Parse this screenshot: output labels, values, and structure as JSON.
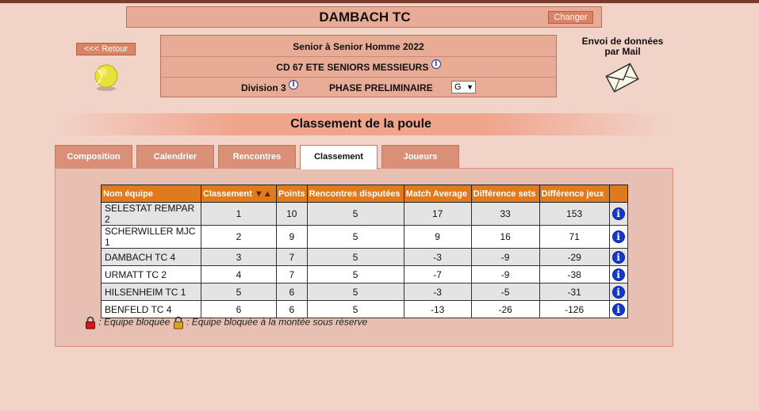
{
  "club": {
    "name": "DAMBACH TC",
    "change_label": "Changer"
  },
  "nav": {
    "back_label": "<<< Retour"
  },
  "competition": {
    "category": "Senior  à Senior  Homme  2022",
    "championship": "CD 67 ETE SENIORS MESSIEURS",
    "division": "Division 3",
    "phase": "PHASE PRELIMINAIRE",
    "poule_selected": "G"
  },
  "mail": {
    "line1": "Envoi de données",
    "line2": "par Mail"
  },
  "section_title": "Classement de la poule",
  "tabs": [
    {
      "label": "Composition",
      "active": false
    },
    {
      "label": "Calendrier",
      "active": false
    },
    {
      "label": "Rencontres",
      "active": false
    },
    {
      "label": "Classement",
      "active": true
    },
    {
      "label": "Joueurs",
      "active": false
    }
  ],
  "table": {
    "headers": {
      "team": "Nom équipe",
      "rank": "Classement",
      "points": "Points",
      "played": "Rencontres disputées",
      "match_avg": "Match Average",
      "sets_diff": "Différence sets",
      "games_diff": "Différence jeux"
    },
    "rows": [
      {
        "team": "SELESTAT REMPAR 2",
        "rank": "1",
        "points": "10",
        "played": "5",
        "match_avg": "17",
        "sets_diff": "33",
        "games_diff": "153"
      },
      {
        "team": "SCHERWILLER MJC 1",
        "rank": "2",
        "points": "9",
        "played": "5",
        "match_avg": "9",
        "sets_diff": "16",
        "games_diff": "71"
      },
      {
        "team": "DAMBACH TC 4",
        "rank": "3",
        "points": "7",
        "played": "5",
        "match_avg": "-3",
        "sets_diff": "-9",
        "games_diff": "-29"
      },
      {
        "team": "URMATT TC 2",
        "rank": "4",
        "points": "7",
        "played": "5",
        "match_avg": "-7",
        "sets_diff": "-9",
        "games_diff": "-38"
      },
      {
        "team": "HILSENHEIM TC 1",
        "rank": "5",
        "points": "6",
        "played": "5",
        "match_avg": "-3",
        "sets_diff": "-5",
        "games_diff": "-31"
      },
      {
        "team": "BENFELD TC 4",
        "rank": "6",
        "points": "6",
        "played": "5",
        "match_avg": "-13",
        "sets_diff": "-26",
        "games_diff": "-126"
      }
    ]
  },
  "legend": {
    "locked": ": Equipe bloquée",
    "locked_reserve": ": Equipe bloquée à la montée sous réserve"
  },
  "colors": {
    "page_bg": "#f2d3c8",
    "box_bg": "#e8ab96",
    "button_bg": "#d98466",
    "header_orange": "#e07a1c",
    "info_blue": "#1438c8",
    "tab_bg": "#d98f78"
  },
  "icons": {
    "ball": "tennis-ball-icon",
    "mail": "envelope-icon",
    "info": "info-icon",
    "lock_red": "red-lock-icon",
    "lock_gold": "gold-lock-icon"
  }
}
